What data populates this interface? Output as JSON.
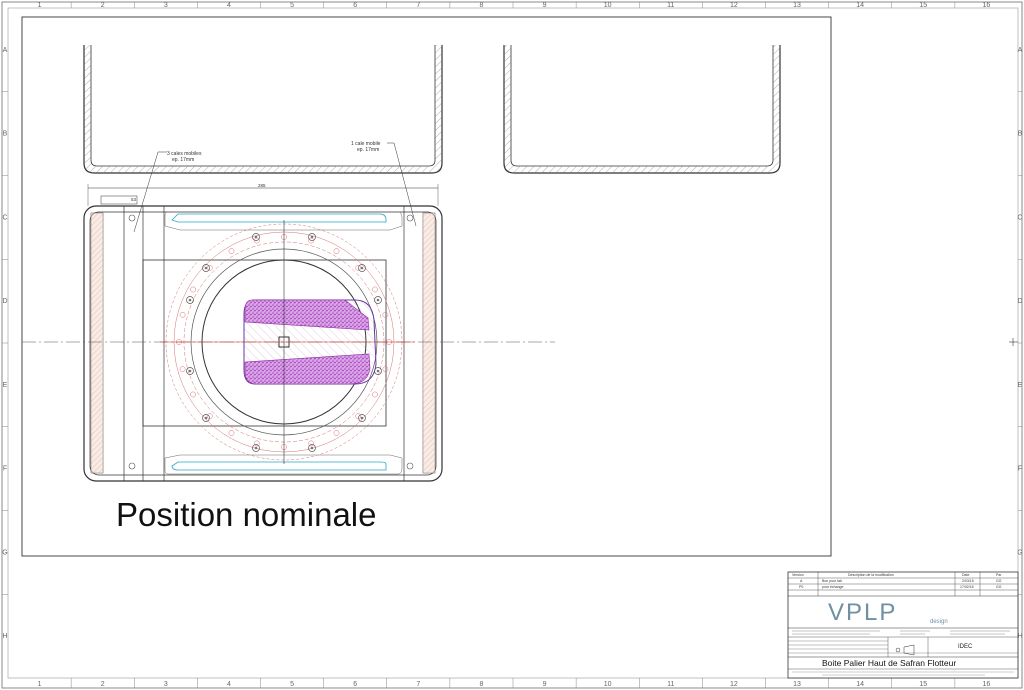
{
  "border": {
    "columns": [
      "1",
      "2",
      "3",
      "4",
      "5",
      "6",
      "7",
      "8",
      "9",
      "10",
      "11",
      "12",
      "13",
      "14",
      "15",
      "16"
    ],
    "rows": [
      "A",
      "B",
      "C",
      "D",
      "E",
      "F",
      "G",
      "H"
    ]
  },
  "drawing": {
    "caption": "Position nominale",
    "notes": {
      "left_line1": "3 cales mobiles",
      "left_line2": "ep. 17mm",
      "right_line1": "1 cale mobile",
      "right_line2": "ep. 17mm"
    },
    "dimensions": {
      "overall": "285",
      "small": "53"
    }
  },
  "title_block": {
    "revision_headers": {
      "version": "Version",
      "description": "Description de la modification",
      "date": "Date",
      "by": "Par"
    },
    "revisions": [
      {
        "version": "A",
        "description": "Bon pour fab",
        "date": "2/03/15",
        "by": "GG"
      },
      {
        "version": "P0",
        "description": "pour échange",
        "date": "17/02/15",
        "by": "GG"
      }
    ],
    "logo_text": "VPLP",
    "logo_sub": "design",
    "client": "IDEC",
    "title": "Boite Palier Haut de Safran Flotteur"
  }
}
